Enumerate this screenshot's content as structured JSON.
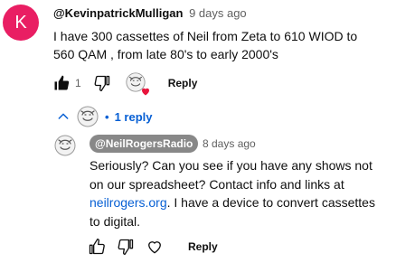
{
  "comment": {
    "avatar_letter": "K",
    "avatar_color": "#e91e63",
    "author": "@KevinpatrickMulligan",
    "timestamp": "9 days ago",
    "text": "I have 300 cassettes of Neil from Zeta to 610 WIOD to 560 QAM , from late 80's to early 2000's",
    "like_count": "1",
    "reply_label": "Reply",
    "icons": {
      "like": "thumb-up-filled-icon",
      "dislike": "thumb-down-icon",
      "creator_heart": "creator-heart-avatar-icon"
    }
  },
  "replies_toggle": {
    "dot": "•",
    "label": "1 reply",
    "icons": {
      "toggle": "chevron-up-icon",
      "avatar": "creator-avatar-icon"
    }
  },
  "reply": {
    "author": "@NeilRogersRadio",
    "timestamp": "8 days ago",
    "text_before_link": "Seriously? Can you see if you have any shows not on our spreadsheet? Contact info and links at ",
    "link_text": "neilrogers.org",
    "text_after_link": ". I have a device to convert cassettes to digital.",
    "reply_label": "Reply",
    "icons": {
      "like": "thumb-up-icon",
      "dislike": "thumb-down-icon",
      "heart": "heart-icon"
    }
  },
  "colors": {
    "link": "#065fd4",
    "heart": "#e8143c",
    "author_chip_bg": "#888888",
    "muted": "#606060"
  }
}
